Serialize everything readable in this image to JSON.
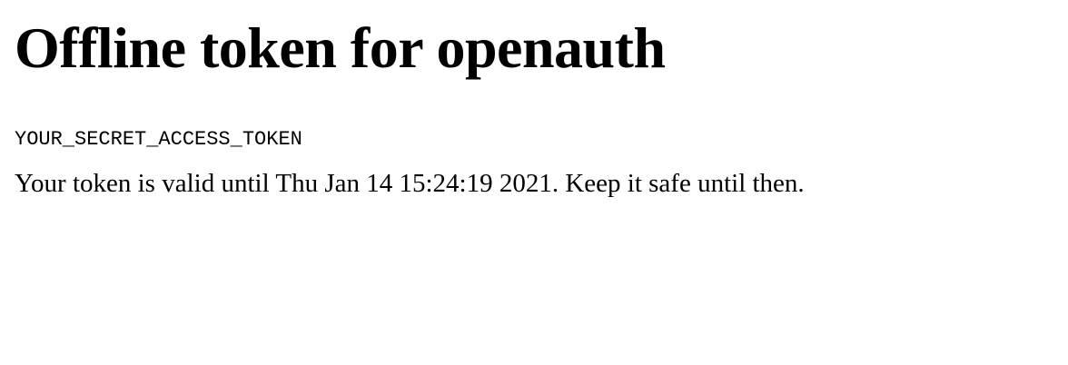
{
  "page": {
    "heading": "Offline token for openauth",
    "token": "YOUR_SECRET_ACCESS_TOKEN",
    "validity_text": "Your token is valid until Thu Jan 14 15:24:19 2021. Keep it safe until then."
  }
}
